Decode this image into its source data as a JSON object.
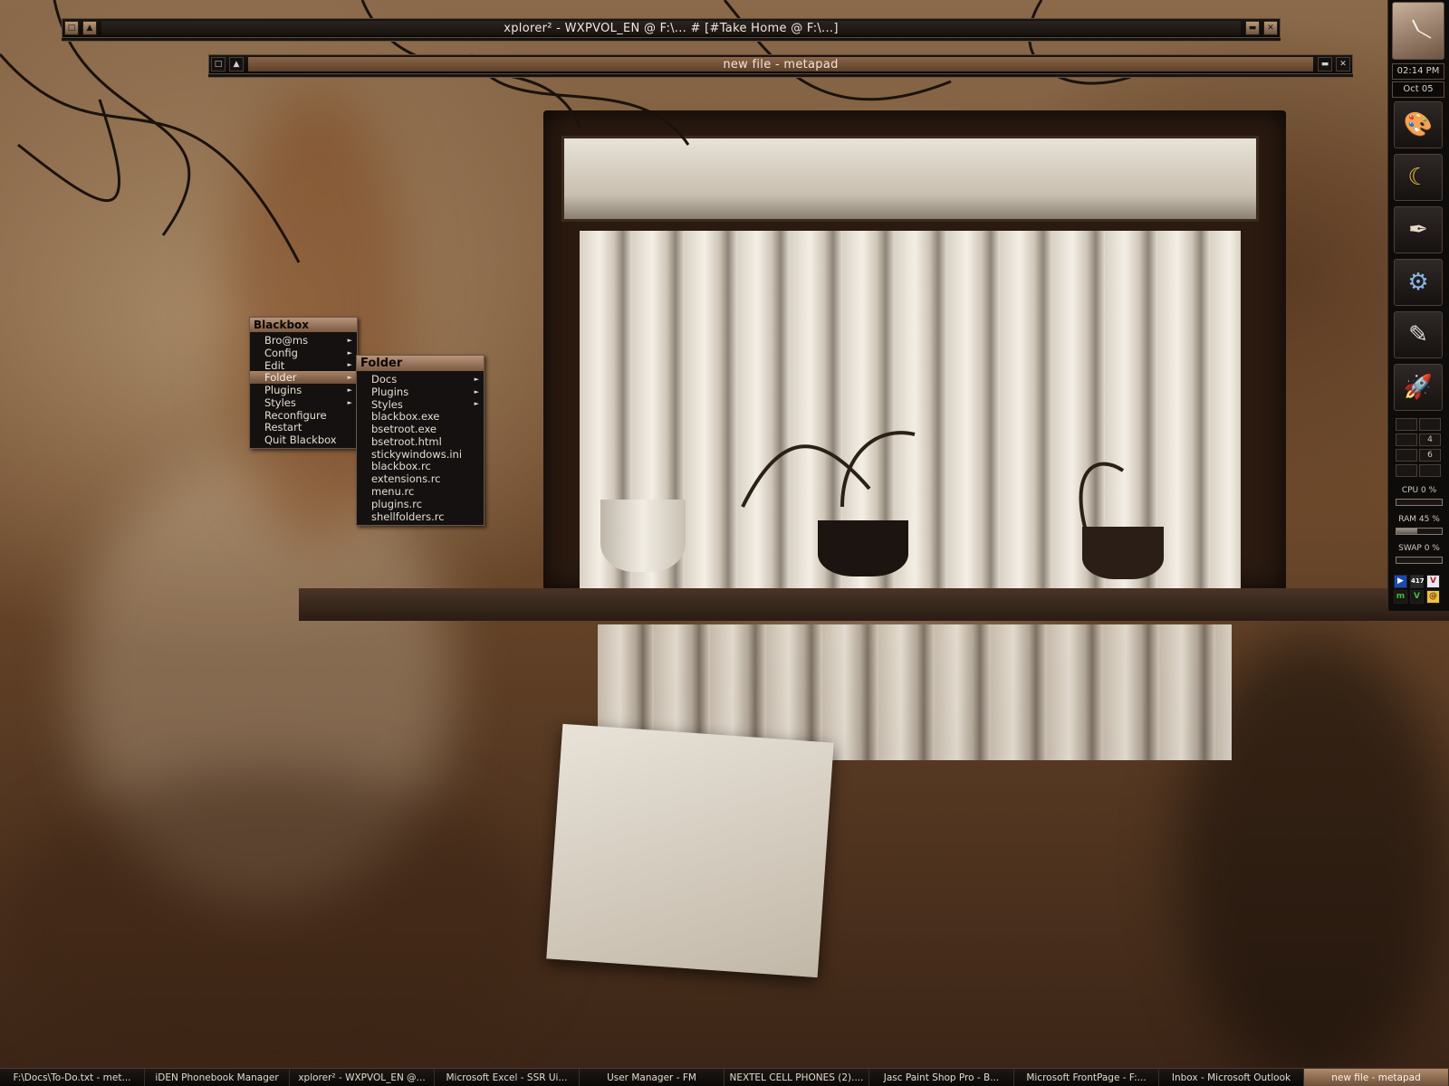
{
  "colors": {
    "accent": "#a88468",
    "menu_bg": "#141110",
    "panel_bg": "#0e0c0a"
  },
  "windows": [
    {
      "title": "xplorer² - WXPVOL_EN @ F:\\... # [#Take Home @ F:\\...]"
    },
    {
      "title": "new file - metapad"
    }
  ],
  "root_menu": {
    "title": "Blackbox",
    "items": [
      {
        "label": "Bro@ms",
        "submenu": true
      },
      {
        "label": "Config",
        "submenu": true
      },
      {
        "label": "Edit",
        "submenu": true
      },
      {
        "label": "Folder",
        "submenu": true,
        "active": true
      },
      {
        "label": "Plugins",
        "submenu": true
      },
      {
        "label": "Styles",
        "submenu": true
      },
      {
        "label": "Reconfigure",
        "submenu": false
      },
      {
        "label": "Restart",
        "submenu": false
      },
      {
        "label": "Quit Blackbox",
        "submenu": false
      }
    ]
  },
  "folder_menu": {
    "title": "Folder",
    "items": [
      {
        "label": "Docs",
        "submenu": true
      },
      {
        "label": "Plugins",
        "submenu": true
      },
      {
        "label": "Styles",
        "submenu": true
      },
      {
        "label": "blackbox.exe",
        "submenu": false
      },
      {
        "label": "bsetroot.exe",
        "submenu": false
      },
      {
        "label": "bsetroot.html",
        "submenu": false
      },
      {
        "label": "stickywindows.ini",
        "submenu": false
      },
      {
        "label": "blackbox.rc",
        "submenu": false
      },
      {
        "label": "extensions.rc",
        "submenu": false
      },
      {
        "label": "menu.rc",
        "submenu": false
      },
      {
        "label": "plugins.rc",
        "submenu": false
      },
      {
        "label": "shellfolders.rc",
        "submenu": false
      }
    ]
  },
  "slit": {
    "time": "02:14 PM",
    "date": "Oct 05",
    "launchers": [
      "palette-icon",
      "moon-icon",
      "feather-icon",
      "gear-icon",
      "pen-icon",
      "rocket-icon"
    ],
    "workspaces": [
      "",
      "",
      "",
      "4",
      "",
      "6",
      "",
      ""
    ],
    "cpu": {
      "label": "CPU 0 %",
      "value": 0
    },
    "ram": {
      "label": "RAM 45 %",
      "value": 45
    },
    "swap": {
      "label": "SWAP 0 %",
      "value": 0
    },
    "tray": [
      "play",
      "417",
      "V",
      "m",
      "V",
      "@"
    ]
  },
  "taskbar": [
    {
      "label": "F:\\Docs\\To-Do.txt - met...",
      "active": false
    },
    {
      "label": "iDEN Phonebook Manager",
      "active": false
    },
    {
      "label": "xplorer² - WXPVOL_EN @...",
      "active": false
    },
    {
      "label": "Microsoft Excel - SSR Ui...",
      "active": false
    },
    {
      "label": "User Manager - FM",
      "active": false
    },
    {
      "label": "NEXTEL CELL PHONES (2)....",
      "active": false
    },
    {
      "label": "Jasc Paint Shop Pro - B...",
      "active": false
    },
    {
      "label": "Microsoft FrontPage - F:...",
      "active": false
    },
    {
      "label": "Inbox - Microsoft Outlook",
      "active": false
    },
    {
      "label": "new file - metapad",
      "active": true
    }
  ]
}
